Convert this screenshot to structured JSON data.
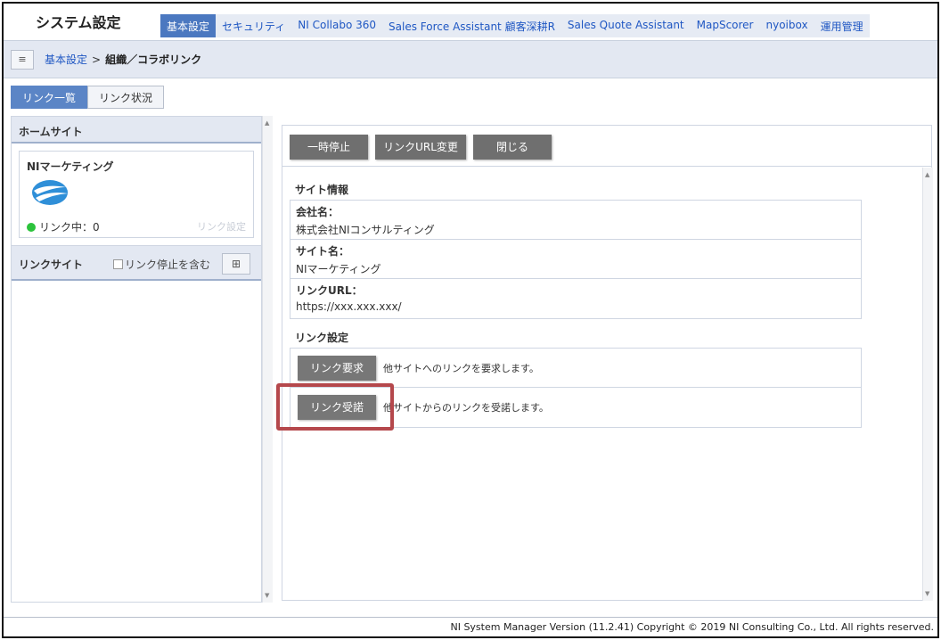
{
  "header": {
    "title": "システム設定",
    "tabs": [
      "基本設定",
      "セキュリティ",
      "NI Collabo 360",
      "Sales Force Assistant 顧客深耕R",
      "Sales Quote Assistant",
      "MapScorer",
      "nyoibox",
      "運用管理"
    ]
  },
  "breadcrumb": {
    "menu_icon": "≡",
    "parent": "基本設定",
    "separator": ">",
    "current": "組織／コラボリンク"
  },
  "subtabs": [
    "リンク一覧",
    "リンク状況"
  ],
  "left": {
    "home_head": "ホームサイト",
    "home_name": "NIマーケティング",
    "status": "リンク中：0",
    "link_setting": "リンク設定",
    "link_site_head": "リンクサイト",
    "include_stopped": "リンク停止を含む",
    "grid_icon": "⊞"
  },
  "toolbar": {
    "pause": "一時停止",
    "change_url": "リンクURL変更",
    "close": "閉じる"
  },
  "site_info": {
    "title": "サイト情報",
    "rows": [
      {
        "k": "会社名：",
        "v": "株式会社NIコンサルティング"
      },
      {
        "k": "サイト名：",
        "v": "NIマーケティング"
      },
      {
        "k": "リンクURL：",
        "v": "https://xxx.xxx.xxx/"
      }
    ]
  },
  "link_settings": {
    "title": "リンク設定",
    "request_btn": "リンク要求",
    "request_desc": "他サイトへのリンクを要求します。",
    "accept_btn": "リンク受諾",
    "accept_desc": "他サイトからのリンクを受諾します。"
  },
  "footer": "NI System Manager Version (11.2.41) Copyright © 2019 NI Consulting Co., Ltd. All rights reserved."
}
